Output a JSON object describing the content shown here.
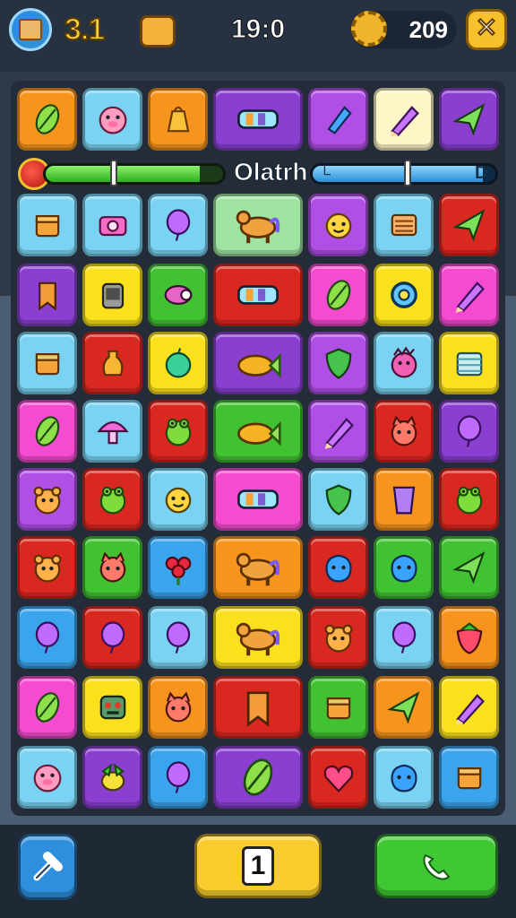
{
  "header": {
    "level_text": "3.1",
    "timer": "19:0",
    "coins": "209",
    "close_label": "✕"
  },
  "progress": {
    "label": "Olatrh",
    "left_fill": 0.87,
    "right_fill": 0.93,
    "right_left_mark": "└",
    "right_end_mark": "D"
  },
  "footer": {
    "center_number": "1"
  },
  "colors": {
    "orange": "#f7941d",
    "sky": "#7ad3f2",
    "purple": "#8a3fd1",
    "violet": "#b04fe6",
    "cream": "#fff6c8",
    "red": "#d9281f",
    "green": "#41c232",
    "yellow": "#fbe11d",
    "pink": "#f54bd0",
    "blue": "#3aa4ec",
    "mint": "#9fe3a0"
  },
  "grid": [
    [
      "orange:leaf",
      "sky:pig",
      "orange:bag",
      "purple:tube",
      "violet:pen",
      "cream:pencil",
      "purple:plane"
    ],
    [
      "sky:box",
      "sky:camera",
      "sky:balloon",
      "mint:horse",
      "violet:face",
      "sky:scroll",
      "red:plane"
    ],
    [
      "purple:tag",
      "yellow:device",
      "green:barrel",
      "red:tube",
      "pink:leaf",
      "yellow:gear",
      "pink:pencil"
    ],
    [
      "sky:box",
      "red:bottle",
      "yellow:apple",
      "purple:fish",
      "violet:shield",
      "sky:monster",
      "yellow:towel"
    ],
    [
      "pink:leaf",
      "sky:mushroom",
      "red:frog",
      "green:fish",
      "violet:pencil",
      "red:cat",
      "purple:balloon"
    ],
    [
      "violet:bear",
      "red:frog",
      "sky:face",
      "pink:tube",
      "sky:shield",
      "orange:cup",
      "red:frog"
    ],
    [
      "red:bear",
      "green:cat",
      "blue:flower",
      "orange:horse",
      "red:blob",
      "green:blob",
      "green:plane"
    ],
    [
      "blue:balloon",
      "red:balloon",
      "sky:balloon",
      "yellow:horse",
      "red:bear",
      "sky:balloon",
      "orange:strawberry"
    ],
    [
      "pink:leaf",
      "yellow:robot",
      "orange:cat",
      "red:tag",
      "green:box",
      "orange:plane",
      "yellow:pencil"
    ],
    [
      "sky:pig",
      "purple:bird",
      "blue:balloon",
      "purple:leaf",
      "red:heart",
      "sky:blob",
      "blue:box"
    ]
  ]
}
